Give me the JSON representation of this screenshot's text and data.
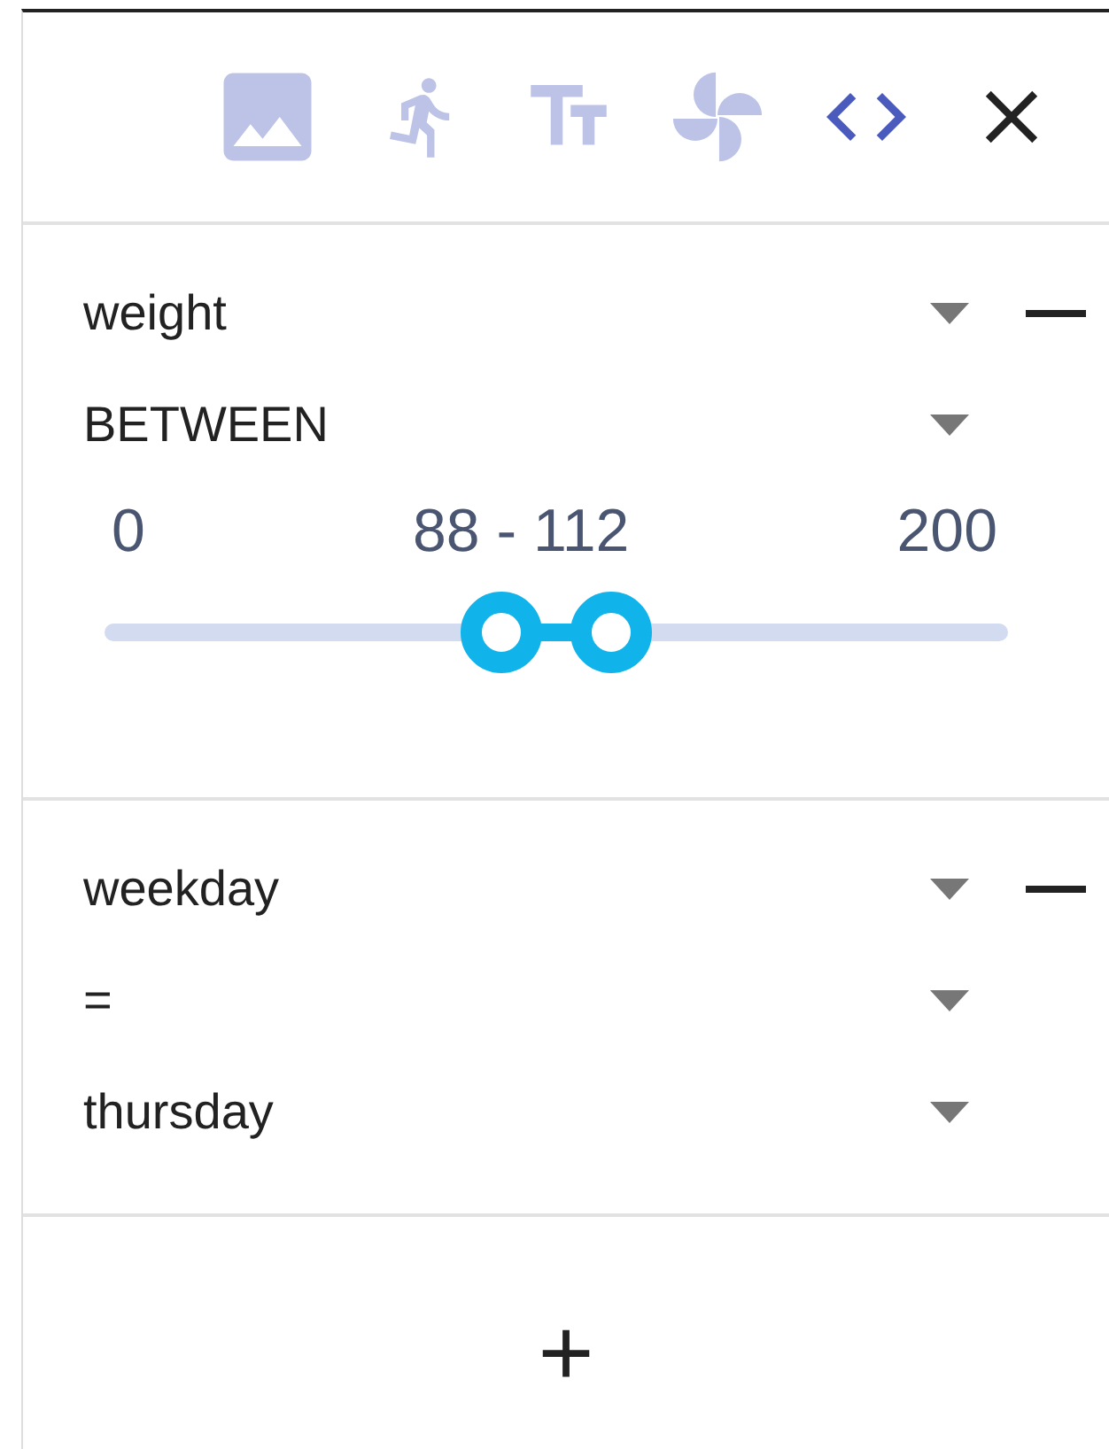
{
  "toolbar": [
    {
      "kind": "image",
      "active": false
    },
    {
      "kind": "run",
      "active": false
    },
    {
      "kind": "text",
      "active": false
    },
    {
      "kind": "pinwheel",
      "active": false
    },
    {
      "kind": "code",
      "active": true
    },
    {
      "kind": "close"
    }
  ],
  "filters": [
    {
      "selects": [
        "weight",
        "BETWEEN"
      ],
      "slider": {
        "min": "0",
        "reading": "88 - 112",
        "max": "200",
        "thumbs": [
          {
            "level": 0.44
          },
          {
            "level": 0.56
          }
        ]
      }
    },
    {
      "selects": [
        "weekday",
        "=",
        "thursday"
      ]
    }
  ],
  "add_button": "+"
}
